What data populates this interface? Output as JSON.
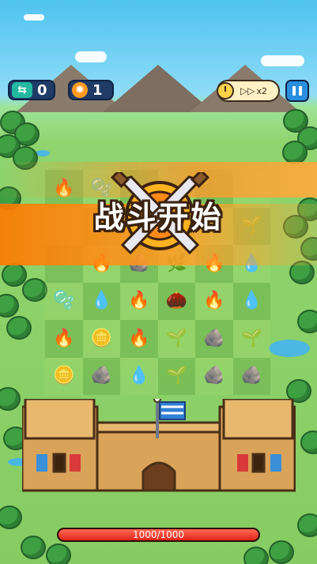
{
  "hud": {
    "gems": {
      "icon": "shuffle-icon",
      "value": "0"
    },
    "coins": {
      "icon": "gear-coin-icon",
      "value": "1"
    },
    "speed_label": "x2",
    "pause_icon": "pause-icon"
  },
  "banner": {
    "text": "战斗开始"
  },
  "board": {
    "rows": 6,
    "cols": 6,
    "cells": [
      [
        "fire",
        "slime",
        "empty",
        "empty",
        "empty",
        "empty"
      ],
      [
        "empty",
        "empty",
        "empty",
        "empty",
        "empty",
        "sprout"
      ],
      [
        "empty",
        "fire-sprite",
        "rock-golem",
        "leaf-golem",
        "fire",
        "water"
      ],
      [
        "slime",
        "water",
        "fire",
        "sprout-seed",
        "fire-spirit",
        "water"
      ],
      [
        "fire",
        "coin",
        "fire",
        "sprout",
        "rock-golem",
        "sprout"
      ],
      [
        "coin",
        "rock-golem",
        "water",
        "sprout",
        "rock",
        "rock"
      ]
    ]
  },
  "castle": {
    "flag_colors": [
      "#2f7fd6",
      "#ffffff"
    ],
    "banner_colors": [
      "#3b8ed8",
      "#d83a3a"
    ]
  },
  "health": {
    "current": 1000,
    "max": 1000,
    "text": "1000/1000",
    "fill": 1.0
  },
  "colors": {
    "hp": "#e0251b",
    "hud_bg": "#1f3b66",
    "accent": "#2a8fe0",
    "banner": "#ff8c1a"
  }
}
